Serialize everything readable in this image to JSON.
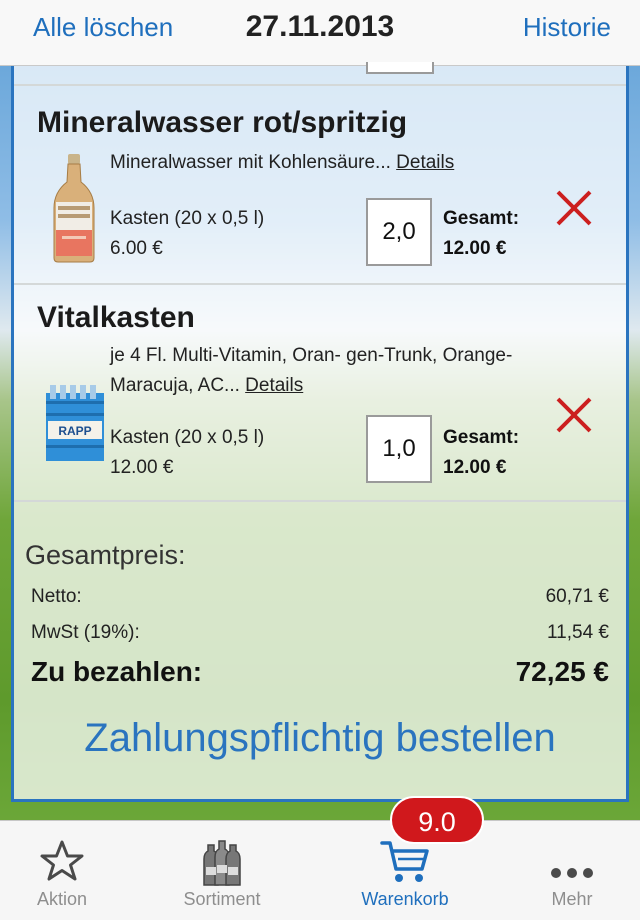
{
  "header": {
    "left_action": "Alle löschen",
    "title": "27.11.2013",
    "right_action": "Historie"
  },
  "items": [
    {
      "title": "Mineralwasser rot/spritzig",
      "description": "Mineralwasser mit Kohlensäure...",
      "details_link": "Details",
      "unit": "Kasten (20 x 0,5 l)",
      "price": "6.00 €",
      "quantity": "2,0",
      "total_label": "Gesamt:",
      "total_value": "12.00 €",
      "image_icon": "mineral-water-bottle-icon"
    },
    {
      "title": "Vitalkasten",
      "description": "je 4 Fl. Multi-Vitamin, Oran- gen-Trunk, Orange-Maracuja, AC...",
      "details_link": "Details",
      "unit": "Kasten (20 x 0,5 l)",
      "price": "12.00 €",
      "quantity": "1,0",
      "total_label": "Gesamt:",
      "total_value": "12.00 €",
      "image_icon": "bottle-crate-icon",
      "image_text": "RAPP"
    }
  ],
  "summary": {
    "heading": "Gesamtpreis:",
    "netto_label": "Netto:",
    "netto_value": "60,71 €",
    "mwst_label": "MwSt (19%):",
    "mwst_value": "11,54 €",
    "pay_label": "Zu bezahlen:",
    "pay_value": "72,25 €"
  },
  "order_button": "Zahlungspflichtig bestellen",
  "tabs": [
    {
      "label": "Aktion",
      "icon": "star-icon",
      "active": false
    },
    {
      "label": "Sortiment",
      "icon": "bottles-icon",
      "active": false
    },
    {
      "label": "Warenkorb",
      "icon": "cart-icon",
      "active": true
    },
    {
      "label": "Mehr",
      "icon": "more-icon",
      "active": false
    }
  ],
  "cart_badge": "9.0",
  "colors": {
    "accent": "#1f6fbd",
    "remove": "#cc1f1f",
    "badge": "#d0181c",
    "panel_border": "#2a74bf"
  }
}
